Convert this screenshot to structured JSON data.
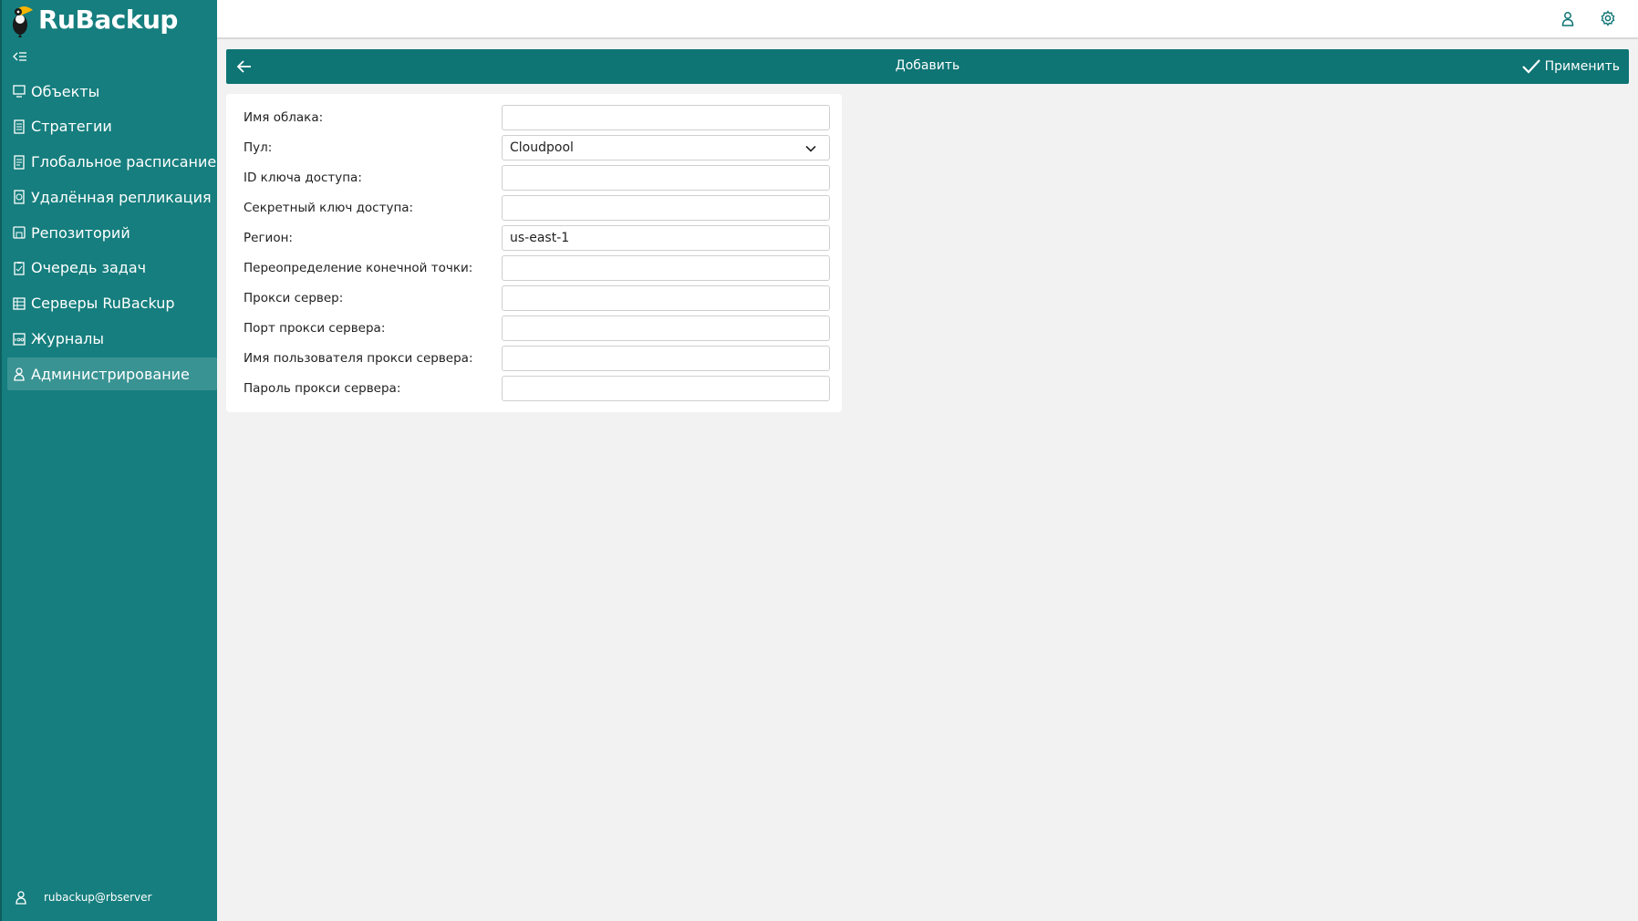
{
  "app": {
    "logo_prefix": "Ru",
    "logo_suffix": "Backup"
  },
  "sidebar": {
    "items": [
      {
        "label": "Объекты",
        "icon": "monitor-icon"
      },
      {
        "label": "Стратегии",
        "icon": "document-list-icon"
      },
      {
        "label": "Глобальное расписание",
        "icon": "schedule-icon"
      },
      {
        "label": "Удалённая репликация",
        "icon": "replication-icon"
      },
      {
        "label": "Репозиторий",
        "icon": "repository-icon"
      },
      {
        "label": "Очередь задач",
        "icon": "task-queue-icon"
      },
      {
        "label": "Серверы RuBackup",
        "icon": "servers-icon"
      },
      {
        "label": "Журналы",
        "icon": "log-icon"
      },
      {
        "label": "Администрирование",
        "icon": "user-admin-icon"
      }
    ],
    "active_index": 8,
    "user": "rubackup@rbserver"
  },
  "header": {
    "title": "Добавить",
    "apply_label": "Применить"
  },
  "form": {
    "cloud_name": {
      "label": "Имя облака:",
      "value": ""
    },
    "pool": {
      "label": "Пул:",
      "value": "Cloudpool"
    },
    "access_key_id": {
      "label": "ID ключа доступа:",
      "value": ""
    },
    "secret_key": {
      "label": "Секретный ключ доступа:",
      "value": ""
    },
    "region": {
      "label": "Регион:",
      "value": "us-east-1"
    },
    "endpoint_override": {
      "label": "Переопределение конечной точки:",
      "value": ""
    },
    "proxy_server": {
      "label": "Прокси сервер:",
      "value": ""
    },
    "proxy_port": {
      "label": "Порт прокси сервера:",
      "value": ""
    },
    "proxy_user": {
      "label": "Имя пользователя прокси сервера:",
      "value": ""
    },
    "proxy_password": {
      "label": "Пароль прокси сервера:",
      "value": ""
    }
  },
  "colors": {
    "sidebar": "#167e7e",
    "header": "#0e7474",
    "active_item": "#3a9393",
    "accent_icon": "#0e7474"
  }
}
